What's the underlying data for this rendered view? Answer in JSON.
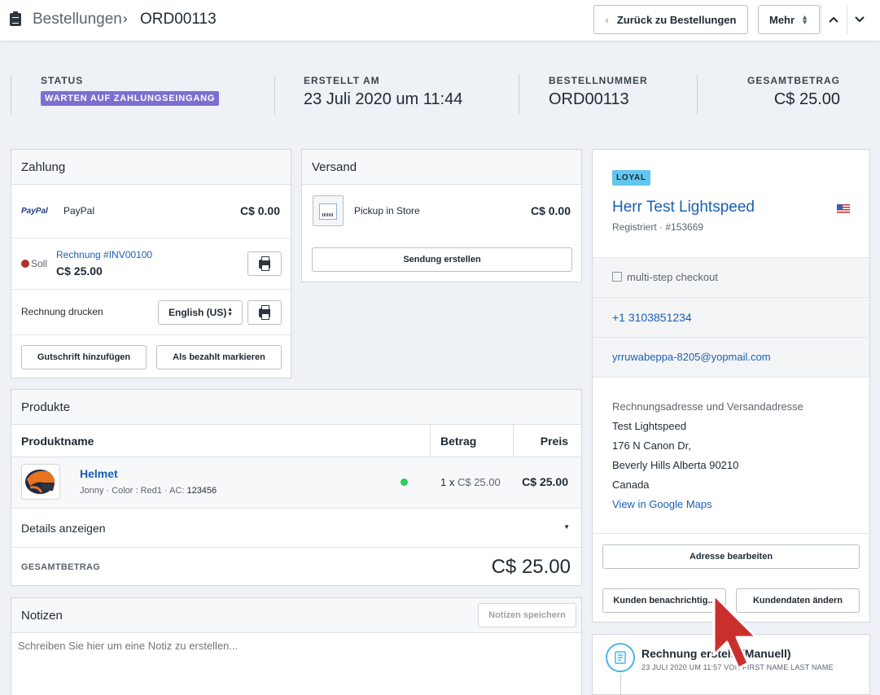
{
  "header": {
    "breadcrumb_parent": "Bestellungen",
    "breadcrumb_sep": "›",
    "breadcrumb_current": "ORD00113",
    "back_button": "Zurück zu Bestellungen",
    "more_button": "Mehr"
  },
  "summary": {
    "status_label": "STATUS",
    "status_value": "WARTEN AUF ZAHLUNGSEINGANG",
    "created_label": "ERSTELLT AM",
    "created_value": "23 Juli 2020 um 11:44",
    "order_label": "BESTELLNUMMER",
    "order_value": "ORD00113",
    "total_label": "GESAMTBETRAG",
    "total_value": "C$ 25.00"
  },
  "payment": {
    "title": "Zahlung",
    "paypal_logo": "PayPal",
    "method": "PayPal",
    "method_amount": "C$ 0.00",
    "due_label": "Soll",
    "invoice_link": "Rechnung #INV00100",
    "invoice_amount": "C$ 25.00",
    "print_invoice_label": "Rechnung drucken",
    "language": "English (US)",
    "credit_button": "Gutschrift hinzufügen",
    "mark_paid_button": "Als bezahlt markieren"
  },
  "shipping": {
    "title": "Versand",
    "method": "Pickup in Store",
    "amount": "C$ 0.00",
    "create_button": "Sendung erstellen"
  },
  "products": {
    "title": "Produkte",
    "columns": [
      "Produktname",
      "Betrag",
      "Preis"
    ],
    "items": [
      {
        "name": "Helmet",
        "meta_prefix": "Jonny · Color : Red1 · AC: ",
        "meta_code": "123456",
        "qty": "1 x ",
        "unit_price": "C$ 25.00",
        "price": "C$ 25.00"
      }
    ],
    "details_label": "Details anzeigen",
    "total_label": "GESAMTBETRAG",
    "total_value": "C$ 25.00"
  },
  "notes": {
    "title": "Notizen",
    "save_button": "Notizen speichern",
    "placeholder": "Schreiben Sie hier um eine Notiz zu erstellen..."
  },
  "customer": {
    "badge": "LOYAL",
    "name": "Herr Test Lightspeed",
    "registered": "Registriert · #153669",
    "checkout": "multi-step checkout",
    "phone": "+1 3103851234",
    "email": "yrruwabeppa-8205@yopmail.com",
    "address_heading": "Rechnungsadresse und Versandadresse",
    "address_lines": [
      "Test Lightspeed",
      "176 N Canon Dr,",
      "Beverly Hills Alberta 90210",
      "Canada"
    ],
    "maps_link": "View in Google Maps",
    "edit_address_button": "Adresse bearbeiten",
    "notify_button": "Kunden benachrichtig...",
    "edit_customer_button": "Kundendaten ändern"
  },
  "timeline": {
    "title": "Rechnung erstellt (Manuell)",
    "meta": "23 JULI 2020 UM 11:57 VON FIRST NAME LAST NAME"
  },
  "colors": {
    "status_badge": "#7b6fd0",
    "loyal_badge": "#63c6ee",
    "link": "#1a5fb4",
    "due_dot": "#b0322c",
    "instock_dot": "#2ecc5a"
  }
}
